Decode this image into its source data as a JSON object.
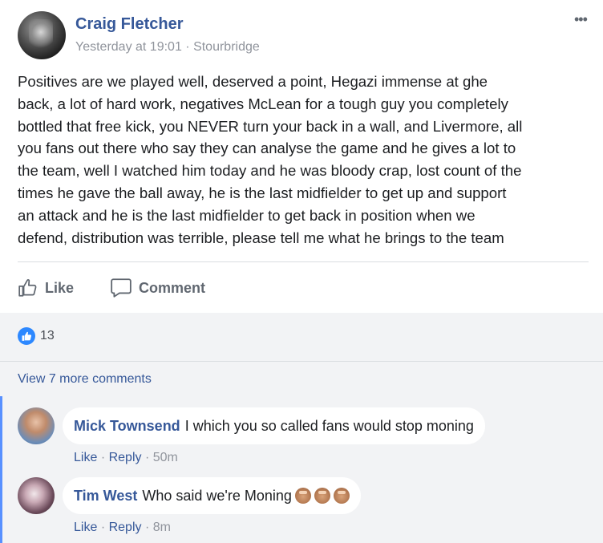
{
  "post": {
    "author": "Craig Fletcher",
    "timestamp": "Yesterday at 19:01",
    "separator": " · ",
    "location": "Stourbridge",
    "more_icon": "•••",
    "text": "Positives are we played well, deserved a point, Hegazi immense at ghe\nback, a lot of hard work, negatives McLean for a tough guy you completely\nbottled that free kick, you NEVER turn your back in a wall, and Livermore, all\nyou fans out there who say they can analyse the game and he gives a lot to\nthe team, well I watched him today and he was bloody crap, lost count of the\ntimes he gave the ball away, he is the last midfielder to get up and support\nan attack and he is the last midfielder to get back in position when we\ndefend, distribution was terrible, please tell me what he brings to the team",
    "like_label": "Like",
    "comment_label": "Comment"
  },
  "reactions": {
    "count": "13",
    "color": "#2d88ff"
  },
  "comments_section": {
    "view_more": "View 7 more comments",
    "comments": [
      {
        "author": "Mick Townsend",
        "text": "I which you so called fans would stop moning",
        "like": "Like",
        "reply": "Reply",
        "time": "50m"
      },
      {
        "author": "Tim West",
        "text": "Who said we're Moning",
        "emoji_icons": [
          "monkey-emoji-icon",
          "monkey-emoji-icon",
          "monkey-emoji-icon"
        ],
        "like": "Like",
        "reply": "Reply",
        "time": "8m"
      }
    ]
  },
  "colors": {
    "link": "#365899",
    "accent": "#5890ff",
    "muted": "#90949c"
  }
}
